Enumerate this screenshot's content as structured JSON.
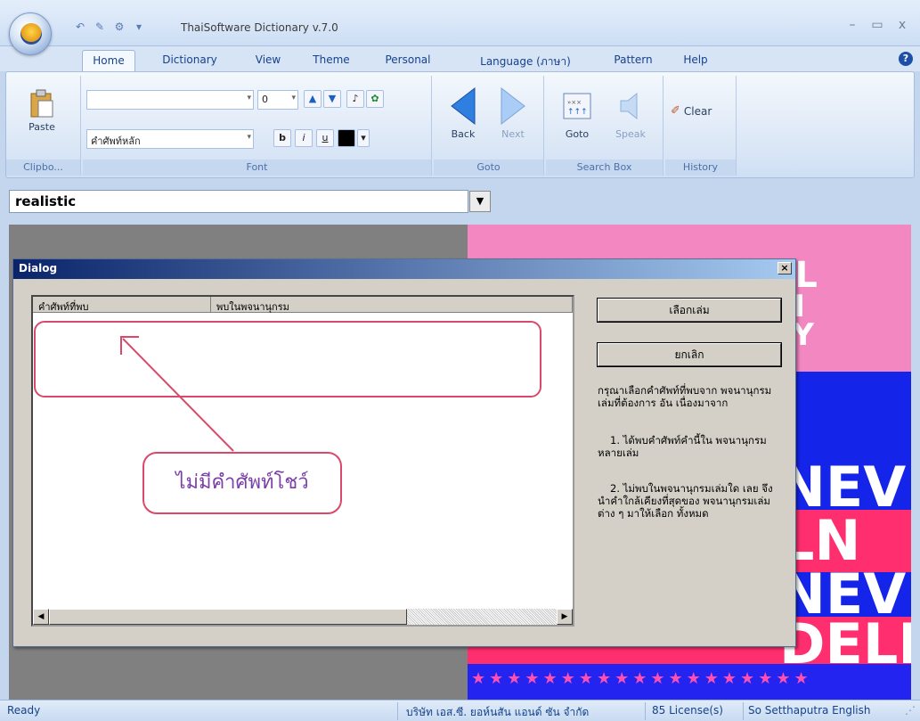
{
  "window": {
    "title": "ThaiSoftware Dictionary v.7.0"
  },
  "ribbon": {
    "tabs": [
      "Home",
      "Dictionary",
      "View",
      "Theme",
      "Personal",
      "Language (ภาษา)",
      "Pattern",
      "Help"
    ],
    "active_tab": "Home",
    "clipboard": {
      "paste_label": "Paste",
      "group_label": "Clipbo..."
    },
    "font": {
      "size_value": "0",
      "font_name": "คำศัพท์หลัก",
      "bold_label": "b",
      "italic_label": "i",
      "underline_label": "u",
      "group_label": "Font"
    },
    "goto": {
      "back_label": "Back",
      "next_label": "Next",
      "group_label": "Goto"
    },
    "search_box": {
      "goto_label": "Goto",
      "speak_label": "Speak",
      "group_label": "Search Box"
    },
    "history": {
      "clear_label": "Clear",
      "group_label": "History"
    }
  },
  "search": {
    "value": "realistic"
  },
  "dialog": {
    "title": "Dialog",
    "columns": [
      "คำศัพท์ที่พบ",
      "พบในพจนานุกรม"
    ],
    "select_button": "เลือกเล่ม",
    "cancel_button": "ยกเลิก",
    "info_intro": "กรุณาเลือกคำศัพท์ที่พบจาก พจนานุกรมเล่มที่ต้องการ อัน เนื่องมาจาก",
    "info_point1": "1. ได้พบคำศัพท์คำนี้ใน พจนานุกรมหลายเล่ม",
    "info_point2": "2. ไม่พบในพจนานุกรมเล่มใด เลย จึงนำคำใกล้เคียงที่สุดของ พจนานุกรมเล่มต่าง ๆ มาให้เลือก ทั้งหมด"
  },
  "annotation": {
    "label": "ไม่มีคำศัพท์โชว์",
    "color": "#d94a6a"
  },
  "banner": {
    "line1": "EL",
    "line2": "AI",
    "line3": "RY",
    "word1": "NEV",
    "word2": "LN",
    "word3": "NEV",
    "word4": "DELN",
    "stars": "★★★★★★★★★★★★★★★★★★★"
  },
  "statusbar": {
    "status": "Ready",
    "company": "บริษัท เอส.ซี. ยอห์นสัน แอนด์ ซัน จำกัด",
    "license": "85 License(s)",
    "user": "So Setthaputra English"
  }
}
